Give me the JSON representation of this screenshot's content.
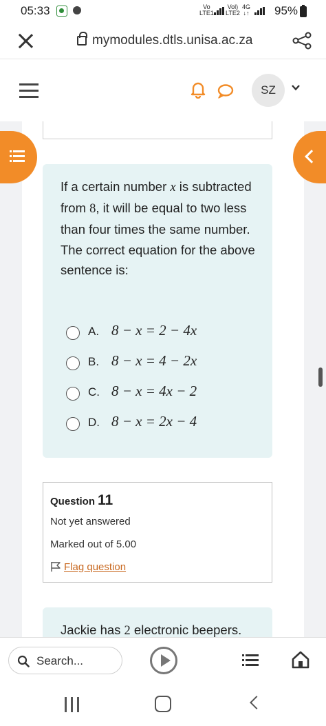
{
  "status_bar": {
    "time": "05:33",
    "sim1_net_top": "Vo",
    "sim1_net_bottom": "LTE1",
    "sim2_net_top": "Vol)",
    "sim2_net_bottom": "LTE2",
    "data_type": "4G",
    "battery": "95%"
  },
  "browser": {
    "url": "mymodules.dtls.unisa.ac.za"
  },
  "header": {
    "avatar_initials": "SZ"
  },
  "question": {
    "text_parts": [
      "If a certain number ",
      "x",
      " is subtracted from ",
      "8",
      ", it will be equal to two less than four times the same number. The correct equation for the above sentence is:"
    ],
    "options": [
      {
        "letter": "A.",
        "equation": "8 − x = 2 − 4x"
      },
      {
        "letter": "B.",
        "equation": "8 − x = 4 − 2x"
      },
      {
        "letter": "C.",
        "equation": "8 − x = 4x − 2"
      },
      {
        "letter": "D.",
        "equation": "8 − x = 2x − 4"
      }
    ]
  },
  "question_info": {
    "label": "Question",
    "number": "11",
    "status": "Not yet answered",
    "marks": "Marked out of 5.00",
    "flag_label": "Flag question"
  },
  "next_question": {
    "text_parts": [
      "Jackie has ",
      "2",
      " electronic beepers."
    ]
  },
  "bottom_bar": {
    "search_placeholder": "Search..."
  },
  "colors": {
    "accent": "#f28c28",
    "question_bg": "#e6f3f4",
    "link": "#c8681f"
  }
}
